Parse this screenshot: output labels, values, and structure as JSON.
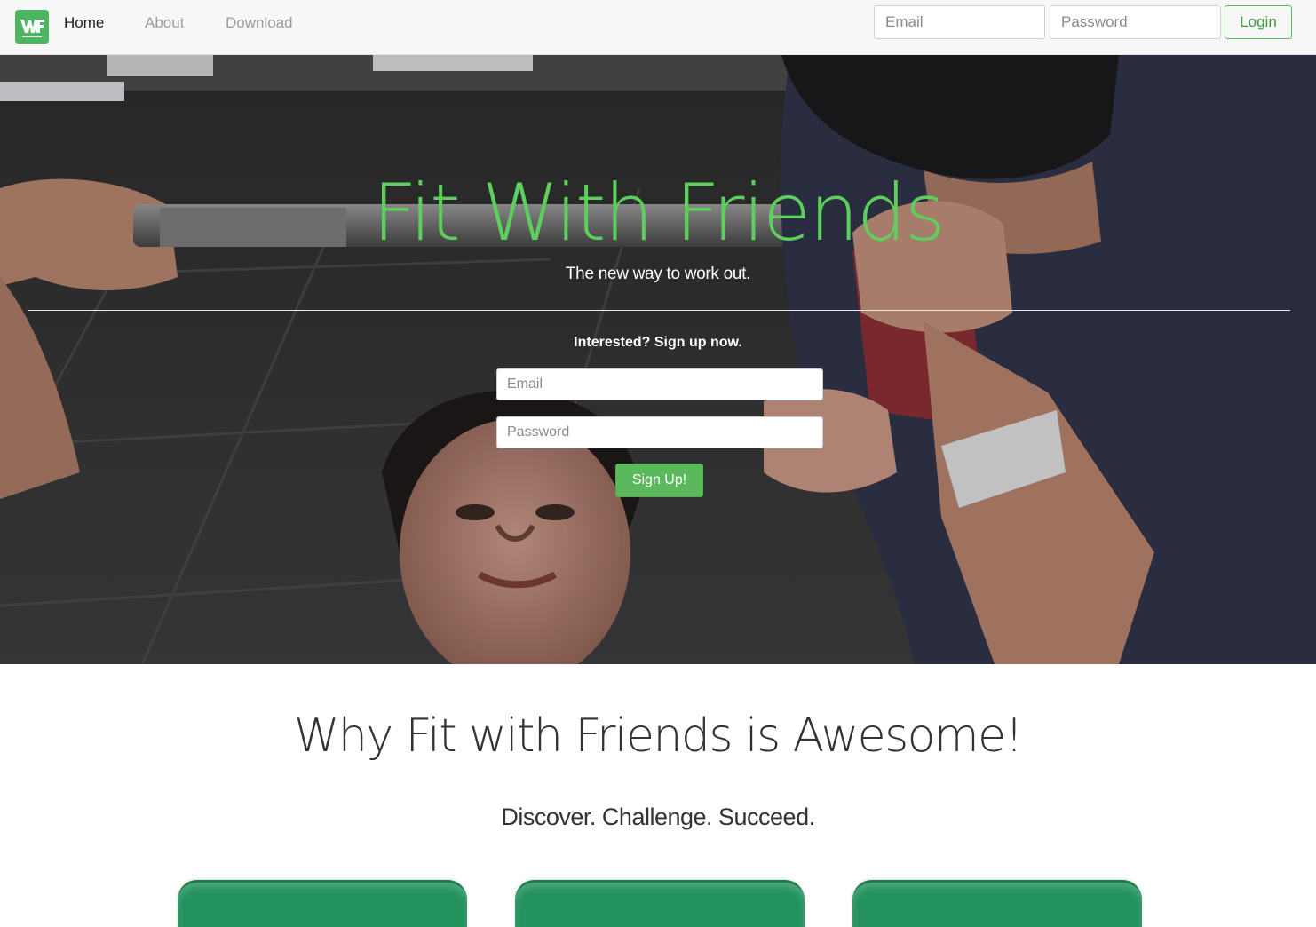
{
  "nav": {
    "logo_icon": "fit-with-friends-logo",
    "links": [
      {
        "label": "Home",
        "active": true
      },
      {
        "label": "About",
        "active": false
      },
      {
        "label": "Download",
        "active": false
      }
    ],
    "email_placeholder": "Email",
    "password_placeholder": "Password",
    "login_label": "Login"
  },
  "hero": {
    "title": "Fit With Friends",
    "subtitle": "The new way to work out.",
    "signup_prompt": "Interested? Sign up now.",
    "email_placeholder": "Email",
    "password_placeholder": "Password",
    "signup_label": "Sign Up!"
  },
  "features": {
    "title": "Why Fit with Friends is Awesome!",
    "tagline": "Discover. Challenge. Succeed."
  },
  "colors": {
    "accent": "#5cb85c",
    "hero_title": "#5ccf5c",
    "card": "#24925f"
  }
}
